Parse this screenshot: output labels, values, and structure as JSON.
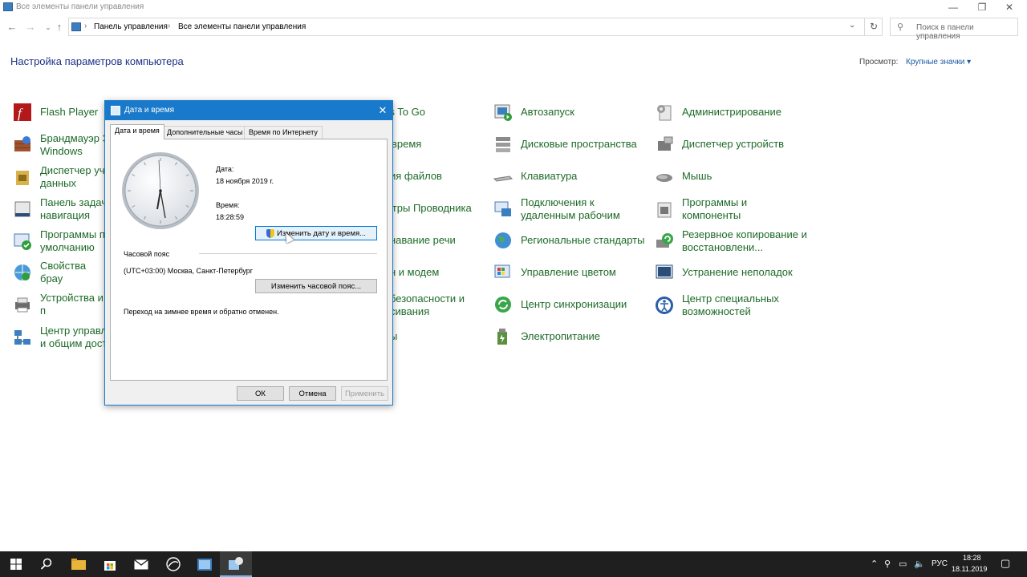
{
  "window": {
    "title": "Все элементы панели управления"
  },
  "address": {
    "crumbs": [
      "Панель управления",
      "Все элементы панели управления"
    ],
    "search_placeholder": "Поиск в панели управления"
  },
  "header": {
    "title": "Настройка параметров компьютера",
    "view_label": "Просмотр:",
    "view_value": "Крупные значки ▾"
  },
  "items": {
    "col1": [
      {
        "label": "Flash Player",
        "icon": "flash-icon"
      },
      {
        "label": "Брандмауэр З\nWindows",
        "icon": "firewall-icon"
      },
      {
        "label": "Диспетчер уч\nданных",
        "icon": "credential-manager-icon"
      },
      {
        "label": "Панель задач\nнавигация",
        "icon": "taskbar-icon"
      },
      {
        "label": "Программы п\nумолчанию",
        "icon": "default-programs-icon"
      },
      {
        "label": "Свойства брау",
        "icon": "internet-options-icon"
      },
      {
        "label": "Устройства и п",
        "icon": "devices-printers-icon"
      },
      {
        "label": "Центр управл\nи общим дост",
        "icon": "network-center-icon"
      }
    ],
    "col2": [
      {
        "label": "ws To Go"
      },
      {
        "label": "время"
      },
      {
        "label": "ия файлов"
      },
      {
        "label": "етры Проводника"
      },
      {
        "label": "навание речи"
      },
      {
        "label": "н и модем"
      },
      {
        "label": "безопасности и\nсивания"
      },
      {
        "label": "ы"
      }
    ],
    "col3": [
      {
        "label": "Автозапуск",
        "icon": "autoplay-icon"
      },
      {
        "label": "Дисковые пространства",
        "icon": "storage-spaces-icon"
      },
      {
        "label": "Клавиатура",
        "icon": "keyboard-icon"
      },
      {
        "label": "Подключения к\nудаленным рабочим",
        "icon": "remote-desktop-icon"
      },
      {
        "label": "Региональные стандарты",
        "icon": "region-icon"
      },
      {
        "label": "Управление цветом",
        "icon": "color-management-icon"
      },
      {
        "label": "Центр синхронизации",
        "icon": "sync-center-icon"
      },
      {
        "label": "Электропитание",
        "icon": "power-options-icon"
      }
    ],
    "col4": [
      {
        "label": "Администрирование",
        "icon": "admin-tools-icon"
      },
      {
        "label": "Диспетчер устройств",
        "icon": "device-manager-icon"
      },
      {
        "label": "Мышь",
        "icon": "mouse-icon"
      },
      {
        "label": "Программы и\nкомпоненты",
        "icon": "programs-features-icon"
      },
      {
        "label": "Резервное копирование и\nвосстановлени...",
        "icon": "backup-icon"
      },
      {
        "label": "Устранение неполадок",
        "icon": "troubleshooting-icon"
      },
      {
        "label": "Центр специальных\nвозможностей",
        "icon": "ease-of-access-icon"
      }
    ]
  },
  "dialog": {
    "title": "Дата и время",
    "tabs": [
      "Дата и время",
      "Дополнительные часы",
      "Время по Интернету"
    ],
    "date_label": "Дата:",
    "date_value": "18 ноября 2019 г.",
    "time_label": "Время:",
    "time_value": "18:28:59",
    "change_datetime_button": "Изменить дату и время...",
    "timezone_label": "Часовой пояс",
    "timezone_value": "(UTC+03:00) Москва, Санкт-Петербург",
    "change_timezone_button": "Изменить часовой пояс...",
    "dst_note": "Переход на зимнее время и обратно отменен.",
    "ok": "ОК",
    "cancel": "Отмена",
    "apply": "Применить"
  },
  "taskbar": {
    "lang": "РУС",
    "time": "18:28",
    "date": "18.11.2019"
  }
}
